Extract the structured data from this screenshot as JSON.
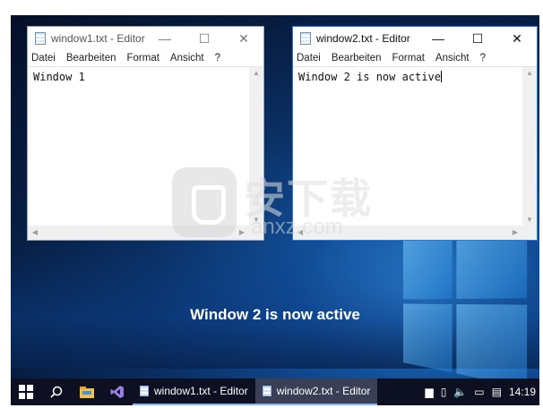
{
  "window1": {
    "title": "window1.txt - Editor",
    "menu": [
      "Datei",
      "Bearbeiten",
      "Format",
      "Ansicht",
      "?"
    ],
    "content": "Window 1"
  },
  "window2": {
    "title": "window2.txt - Editor",
    "menu": [
      "Datei",
      "Bearbeiten",
      "Format",
      "Ansicht",
      "?"
    ],
    "content": "Window 2 is now active"
  },
  "controls": {
    "minimize": "—",
    "maximize": "☐",
    "close": "✕"
  },
  "watermark": {
    "cn": "安下载",
    "url": "anxz.com"
  },
  "caption": "Window 2 is now active",
  "taskbar": {
    "tasks": [
      "window1.txt - Editor",
      "window2.txt - Editor"
    ],
    "clock": "14:19",
    "tray_icons": [
      "notification-stack-icon",
      "usb-icon",
      "volume-icon",
      "network-icon",
      "action-center-icon"
    ]
  }
}
